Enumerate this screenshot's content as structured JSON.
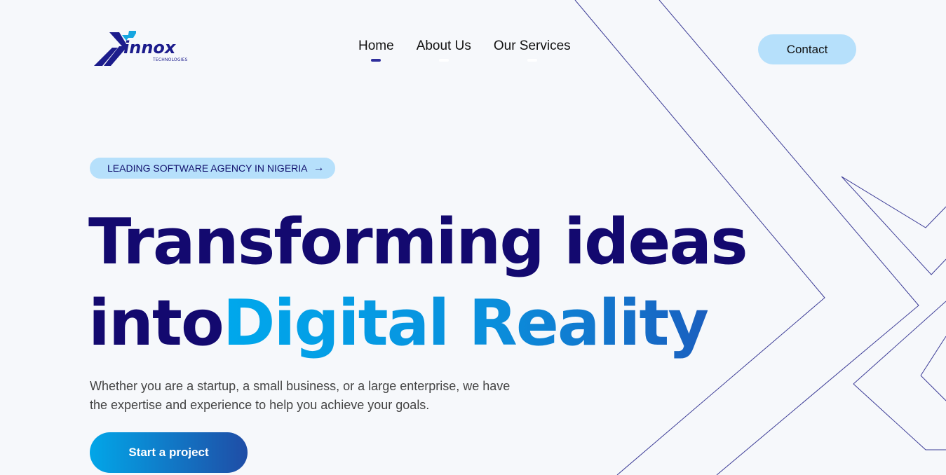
{
  "brand": {
    "name": "innox",
    "tagline": "TECHNOLOGIES",
    "colors": {
      "primary": "#13096f",
      "accent": "#00a8ec",
      "badge": "#b6e0fb"
    }
  },
  "nav": {
    "items": [
      {
        "label": "Home",
        "active": true
      },
      {
        "label": "About Us",
        "active": false
      },
      {
        "label": "Our Services",
        "active": false
      }
    ],
    "contact_label": "Contact"
  },
  "hero": {
    "badge_label": "LEADING SOFTWARE AGENCY IN NIGERIA",
    "badge_icon": "arrow-right-icon",
    "headline_line1": "Transforming ideas",
    "headline_line2_plain": "into",
    "headline_line2_accent": "Digital Reality",
    "subtext": "Whether you are a startup, a small business, or a large enterprise, we have the expertise and experience to help you achieve your goals.",
    "cta_label": "Start a project"
  }
}
